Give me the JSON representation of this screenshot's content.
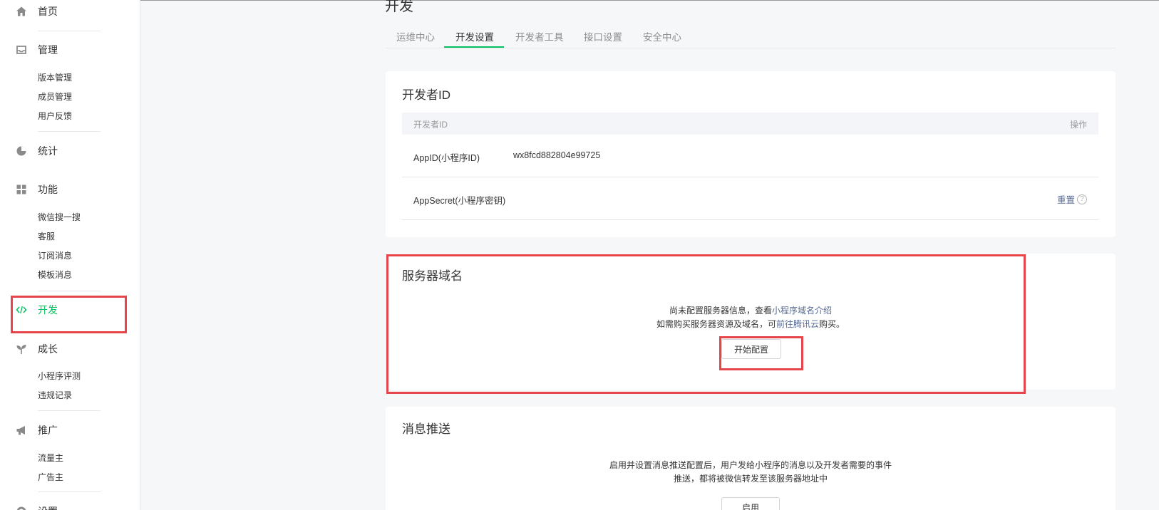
{
  "sidebar": {
    "home": "首页",
    "manage": "管理",
    "manage_items": [
      "版本管理",
      "成员管理",
      "用户反馈"
    ],
    "stats": "统计",
    "features": "功能",
    "feature_items": [
      "微信搜一搜",
      "客服",
      "订阅消息",
      "模板消息"
    ],
    "dev": "开发",
    "growth": "成长",
    "growth_items": [
      "小程序评测",
      "违规记录"
    ],
    "promo": "推广",
    "promo_items": [
      "流量主",
      "广告主"
    ],
    "settings": "设置"
  },
  "page": {
    "title": "开发",
    "tabs": [
      "运维中心",
      "开发设置",
      "开发者工具",
      "接口设置",
      "安全中心"
    ],
    "active_tab": "开发设置"
  },
  "developer_id": {
    "title": "开发者ID",
    "col_id": "开发者ID",
    "col_action": "操作",
    "rows": [
      {
        "label": "AppID(小程序ID)",
        "value": "wx8fcd882804e99725"
      },
      {
        "label": "AppSecret(小程序密钥)",
        "action": "重置",
        "help": "?"
      }
    ]
  },
  "server_domain": {
    "title": "服务器域名",
    "line1_prefix": "尚未配置服务器信息，查看",
    "line1_link": "小程序域名介绍",
    "line2_prefix": "如需购买服务器资源及域名，可",
    "line2_link": "前往腾讯云",
    "line2_suffix": "购买。",
    "button": "开始配置"
  },
  "message_push": {
    "title": "消息推送",
    "desc1": "启用并设置消息推送配置后，用户发给小程序的消息以及开发者需要的事件",
    "desc2": "推送，都将被微信转发至该服务器地址中",
    "button": "启用"
  },
  "colors": {
    "accent": "#07c160",
    "link": "#576b95",
    "highlight": "#e5454b"
  }
}
